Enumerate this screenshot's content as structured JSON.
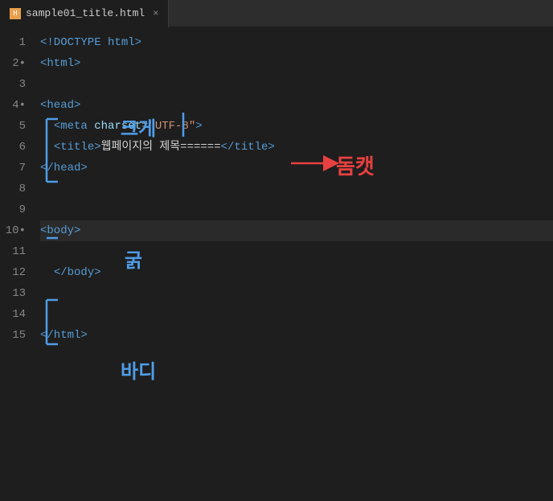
{
  "tab": {
    "filename": "sample01_title.html",
    "close_label": "×"
  },
  "editor": {
    "lines": [
      {
        "number": "1",
        "content": "<!DOCTYPE html>",
        "type": "doctype"
      },
      {
        "number": "2",
        "content": "<html>",
        "type": "tag"
      },
      {
        "number": "3",
        "content": "",
        "type": "empty"
      },
      {
        "number": "4",
        "content": "<head>",
        "type": "tag",
        "indent": 0
      },
      {
        "number": "5",
        "content_parts": [
          {
            "t": "tag",
            "v": "<meta "
          },
          {
            "t": "attr",
            "v": "charset"
          },
          {
            "t": "punct",
            "v": "="
          },
          {
            "t": "str",
            "v": "\"UTF-8\""
          },
          {
            "t": "tag",
            "v": ">"
          }
        ]
      },
      {
        "number": "6",
        "content_parts": [
          {
            "t": "tag",
            "v": "<title>"
          },
          {
            "t": "text",
            "v": "웹페이지의 제목======"
          },
          {
            "t": "tag",
            "v": "</title>"
          }
        ]
      },
      {
        "number": "7",
        "content_parts": [
          {
            "t": "tag",
            "v": "</head>"
          }
        ]
      },
      {
        "number": "8",
        "content": "",
        "type": "empty"
      },
      {
        "number": "9",
        "content": "",
        "type": "empty"
      },
      {
        "number": "10",
        "content_parts": [
          {
            "t": "tag",
            "v": "<body>"
          }
        ],
        "active": true
      },
      {
        "number": "11",
        "content": "",
        "type": "empty",
        "active": false
      },
      {
        "number": "12",
        "content_parts": [
          {
            "t": "tag",
            "v": "</body>"
          }
        ]
      },
      {
        "number": "13",
        "content": "",
        "type": "empty"
      },
      {
        "number": "14",
        "content": "",
        "type": "empty"
      },
      {
        "number": "15",
        "content_parts": [
          {
            "t": "tag",
            "v": "</html>"
          }
        ]
      }
    ]
  },
  "annotations": {
    "head_bracket_label": "크게",
    "head_end_bracket_label": "굵",
    "charset_arrow_label": "돔캣",
    "body_bracket_label": "바디"
  }
}
